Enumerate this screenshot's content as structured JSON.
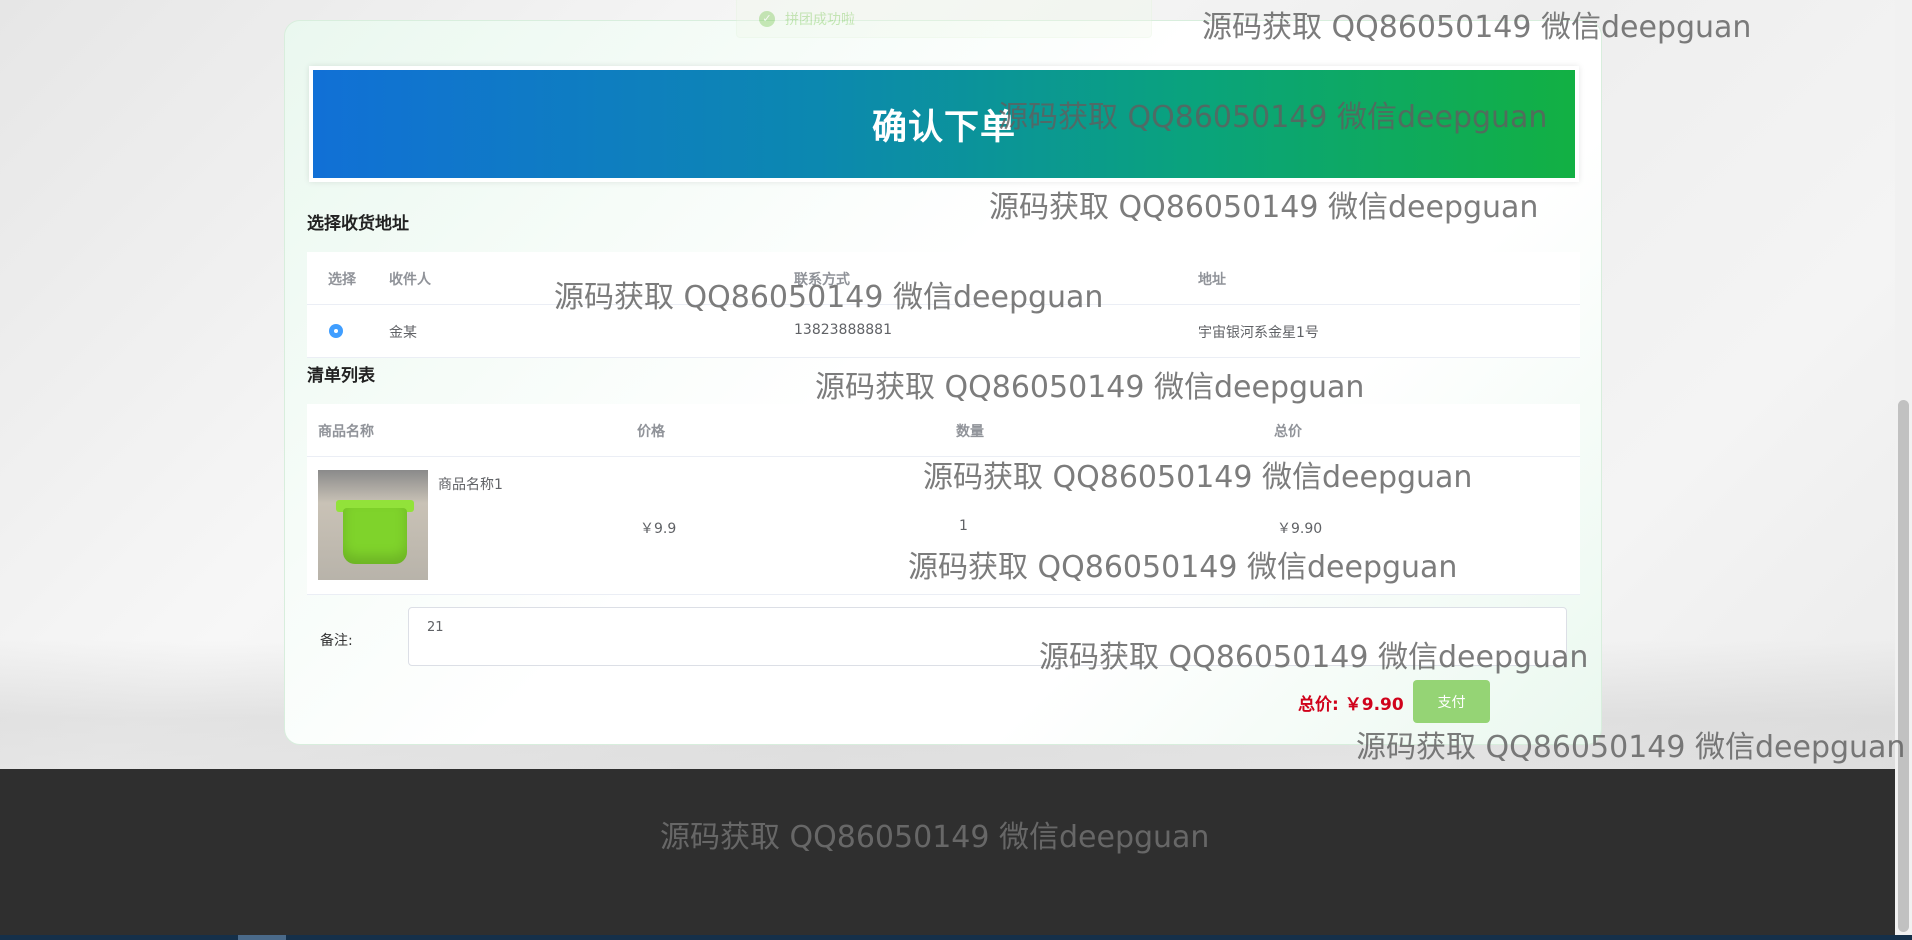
{
  "toast": {
    "message": "拼团成功啦",
    "icon": "check-circle-icon"
  },
  "banner": {
    "title": "确认下单"
  },
  "address_section": {
    "title": "选择收货地址",
    "headers": {
      "select": "选择",
      "recipient": "收件人",
      "contact": "联系方式",
      "address": "地址"
    },
    "rows": [
      {
        "selected": true,
        "recipient": "金某",
        "contact": "13823888881",
        "address": "宇宙银河系金星1号"
      }
    ]
  },
  "order_section": {
    "title": "清单列表",
    "headers": {
      "name": "商品名称",
      "price": "价格",
      "quantity": "数量",
      "total": "总价"
    },
    "rows": [
      {
        "name": "商品名称1",
        "price": "￥9.9",
        "quantity": "1",
        "total": "￥9.90",
        "thumbnail": "green-bin-image"
      }
    ]
  },
  "remark": {
    "label": "备注:",
    "value": "21"
  },
  "summary": {
    "total_label": "总价:",
    "total_value": "￥9.90",
    "pay_button": "支付"
  },
  "watermark": {
    "text": "源码获取 QQ86050149 微信deepguan"
  },
  "colors": {
    "primary": "#409eff",
    "pay_button": "#95d475",
    "total_text": "#d0021b",
    "footer": "#2f2f2f"
  }
}
